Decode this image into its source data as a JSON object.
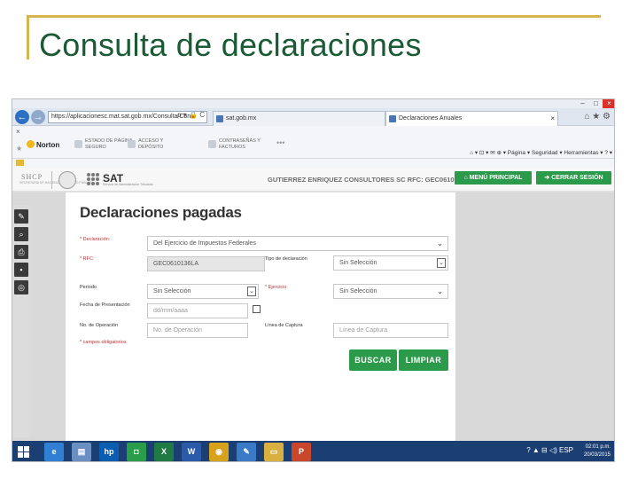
{
  "slide": {
    "title": "Consulta de declaraciones"
  },
  "browser": {
    "window_controls": [
      "–",
      "□",
      "×"
    ],
    "nav_back": "←",
    "nav_forward": "→",
    "address": "https://aplicacionesc.mat.sat.gob.mx/Consulta/Con",
    "address_icons": "ρ ▾ 🔒 C",
    "tabs": [
      {
        "label": "sat.gob.mx"
      },
      {
        "label": "Declaraciones Anuales"
      }
    ],
    "chrome_icons": "⌂ ★ ⚙",
    "favorites_close": "×",
    "norton_label": "Norton",
    "toolbar_items": [
      {
        "line1": "ESTADO DE PÁGINA",
        "line2": "SEGURO"
      },
      {
        "line1": "ACCESO Y",
        "line2": "DEPÓSITO"
      },
      {
        "line1": "CONTRASEÑAS Y",
        "line2": "FACTUROS"
      }
    ],
    "ie_menu": "⌂ ▾ ⊡ ▾ ✉ ⊕ ▾ Página ▾ Seguridad ▾ Herramientas ▾ ? ▾"
  },
  "sat_header": {
    "shcp": "SHCP",
    "shcp_sub": "SECRETARÍA DE HACIENDA Y CRÉDITO PÚBLICO",
    "sat": "SAT",
    "sat_sub": "Servicio de Administración Tributaria",
    "user_rfc": "GUTIERREZ ENRIQUEZ CONSULTORES SC  RFC: GEC0610136LA",
    "menu_button": "MENÚ PRINCIPAL",
    "logout_button": "CERRAR SESIÓN"
  },
  "rail_icons": [
    {
      "name": "edit-icon",
      "glyph": "✎"
    },
    {
      "name": "search-icon",
      "glyph": "⌕"
    },
    {
      "name": "print-icon",
      "glyph": "⎙"
    },
    {
      "name": "save-icon",
      "glyph": "▪"
    },
    {
      "name": "target-icon",
      "glyph": "◎"
    }
  ],
  "form": {
    "heading": "Declaraciones pagadas",
    "declaracion_label": "* Declaración:",
    "declaracion_value": "Del Ejercicio de Impuestos Federales",
    "rfc_label": "* RFC:",
    "rfc_value": "GEC0610136LA",
    "tipo_label": "Tipo de declaración",
    "tipo_value": "Sin Selección",
    "periodo_label": "Periodo",
    "periodo_value": "Sin Selección",
    "ejercicio_label": "* Ejercicio",
    "ejercicio_value": "Sin Selección",
    "fecha_label": "Fecha de Presentación",
    "fecha_placeholder": "dd/mm/aaaa",
    "operacion_label": "No. de Operación",
    "operacion_placeholder": "No. de Operación",
    "captura_label": "Línea de Captura",
    "captura_placeholder": "Línea de Captura",
    "required_note": "* campos obligatorios",
    "buscar_button": "BUSCAR",
    "limpiar_button": "LIMPIAR"
  },
  "taskbar": {
    "apps": [
      {
        "name": "ie-icon",
        "glyph": "e",
        "color": "#2f7fd3"
      },
      {
        "name": "remote-icon",
        "glyph": "▤",
        "color": "#6b8fc2"
      },
      {
        "name": "hp-icon",
        "glyph": "hp",
        "color": "#0a5db1"
      },
      {
        "name": "store-icon",
        "glyph": "◘",
        "color": "#2a9d4b"
      },
      {
        "name": "excel-icon",
        "glyph": "X",
        "color": "#1f7a44"
      },
      {
        "name": "word-icon",
        "glyph": "W",
        "color": "#2b5aa8"
      },
      {
        "name": "chrome-icon",
        "glyph": "◉",
        "color": "#d8a11a"
      },
      {
        "name": "paint-icon",
        "glyph": "✎",
        "color": "#3a7ac6"
      },
      {
        "name": "files-icon",
        "glyph": "▭",
        "color": "#d9b040"
      },
      {
        "name": "powerpoint-icon",
        "glyph": "P",
        "color": "#c9472a"
      }
    ],
    "tray": "?  ▲  ⊟  ◁)  ESP",
    "time": "02:01 p.m.",
    "date": "20/03/2015"
  }
}
